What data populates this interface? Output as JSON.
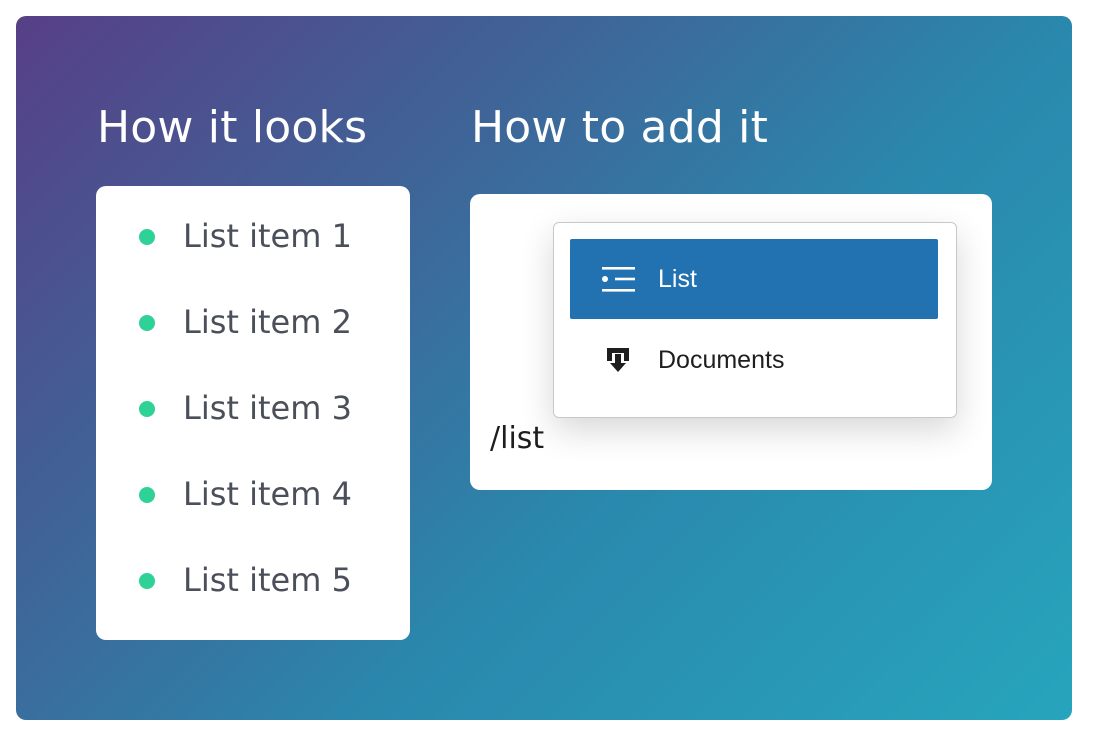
{
  "headings": {
    "looks": "How it looks",
    "add": "How to add it"
  },
  "preview": {
    "items": [
      {
        "label": "List item 1"
      },
      {
        "label": "List item 2"
      },
      {
        "label": "List item 3"
      },
      {
        "label": "List item 4"
      },
      {
        "label": "List item 5"
      }
    ],
    "bullet_color": "#2ed196"
  },
  "editor": {
    "typed_command": "/list",
    "menu": [
      {
        "label": "List",
        "icon": "list-icon",
        "selected": true
      },
      {
        "label": "Documents",
        "icon": "documents-icon",
        "selected": false
      }
    ],
    "selected_color": "#2271b1"
  }
}
